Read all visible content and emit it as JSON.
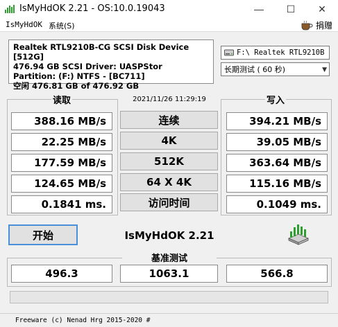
{
  "window": {
    "title": "IsMyHdOK 2.21 - OS:10.0.19043"
  },
  "titlebar": {
    "min": "—",
    "max": "☐",
    "close": "✕"
  },
  "menu": {
    "item1": "IsMyHdOK",
    "item2": "系统(S)",
    "donate": "捐赠"
  },
  "device": {
    "line1": "Realtek RTL9210B-CG SCSI Disk Device [512G]",
    "line2": "476.94 GB  SCSI Driver: UASPStor",
    "line3": "Partition: (F:) NTFS - [BC711]",
    "line4": "空闲 476.81 GB of 476.92 GB"
  },
  "drive_select": {
    "value": "F:\\ Realtek RTL9210B"
  },
  "mode_select": {
    "value": "长期测试 ( 60 秒)",
    "arrow": "▼"
  },
  "headers": {
    "read": "读取",
    "write": "写入",
    "timestamp": "2021/11/26 11:29:19"
  },
  "rows": [
    {
      "read": "388.16 MB/s",
      "label": "连续",
      "write": "394.21 MB/s"
    },
    {
      "read": "22.25 MB/s",
      "label": "4K",
      "write": "39.05 MB/s"
    },
    {
      "read": "177.59 MB/s",
      "label": "512K",
      "write": "363.64 MB/s"
    },
    {
      "read": "124.65 MB/s",
      "label": "64 X 4K",
      "write": "115.16 MB/s"
    },
    {
      "read": "0.1841 ms.",
      "label": "访问时间",
      "write": "0.1049 ms."
    }
  ],
  "start_button": "开始",
  "brand": "IsMyHdOK 2.21",
  "benchmark": {
    "label": "基准测试",
    "read": "496.3",
    "total": "1063.1",
    "write": "566.8"
  },
  "statusbar": "Freeware (c) Nenad Hrg 2015-2020 #",
  "colors": {
    "accent": "#4a90d9",
    "logo_green": "#2e9e2e"
  }
}
